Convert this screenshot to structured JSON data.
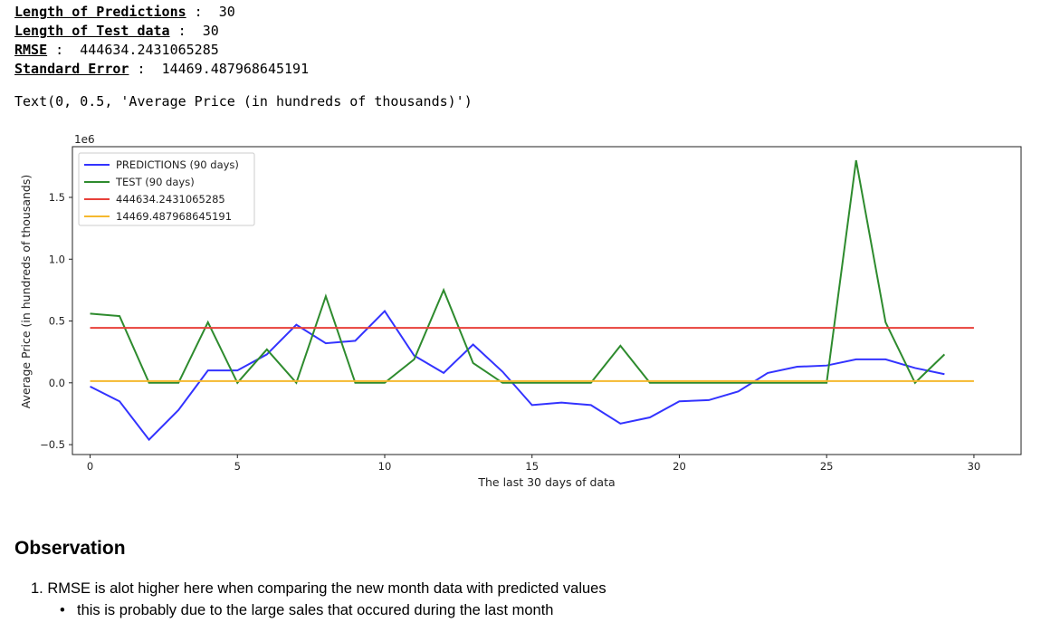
{
  "stats": {
    "pred_label": "Length of Predictions",
    "pred_value": "30",
    "test_label": "Length of Test data",
    "test_value": "30",
    "rmse_label": "RMSE",
    "rmse_value": "444634.2431065285",
    "se_label": "Standard Error",
    "se_value": "14469.487968645191",
    "separator": " : "
  },
  "text_output": "Text(0, 0.5, 'Average Price (in hundreds of thousands)')",
  "chart_data": {
    "type": "line",
    "xlabel": "The last 30 days of data",
    "ylabel": "Average Price (in hundreds of thousands)",
    "offset_text": "1e6",
    "xlim": [
      -0.6,
      31.6
    ],
    "ylim": [
      -0.58,
      1.91
    ],
    "xticks": [
      0,
      5,
      10,
      15,
      20,
      25,
      30
    ],
    "yticks": [
      -0.5,
      0.0,
      0.5,
      1.0,
      1.5
    ],
    "ytick_labels": [
      "−0.5",
      "0.0",
      "0.5",
      "1.0",
      "1.5"
    ],
    "legend_position": "upper-left",
    "series": [
      {
        "name": "PREDICTIONS (90 days)",
        "color": "#3333ff",
        "x": [
          0,
          1,
          2,
          3,
          4,
          5,
          6,
          7,
          8,
          9,
          10,
          11,
          12,
          13,
          14,
          15,
          16,
          17,
          18,
          19,
          20,
          21,
          22,
          23,
          24,
          25,
          26,
          27,
          28,
          29
        ],
        "values": [
          -0.03,
          -0.15,
          -0.46,
          -0.22,
          0.1,
          0.1,
          0.23,
          0.47,
          0.32,
          0.34,
          0.58,
          0.22,
          0.08,
          0.31,
          0.09,
          -0.18,
          -0.16,
          -0.18,
          -0.33,
          -0.28,
          -0.15,
          -0.14,
          -0.07,
          0.08,
          0.13,
          0.14,
          0.19,
          0.19,
          0.12,
          0.07
        ]
      },
      {
        "name": "TEST (90 days)",
        "color": "#2e8b2e",
        "x": [
          0,
          1,
          2,
          3,
          4,
          5,
          6,
          7,
          8,
          9,
          10,
          11,
          12,
          13,
          14,
          15,
          16,
          17,
          18,
          19,
          20,
          21,
          22,
          23,
          24,
          25,
          26,
          27,
          28,
          29
        ],
        "values": [
          0.56,
          0.54,
          0.0,
          0.0,
          0.49,
          0.0,
          0.27,
          0.0,
          0.7,
          0.0,
          0.0,
          0.19,
          0.75,
          0.16,
          0.0,
          0.0,
          0.0,
          0.0,
          0.3,
          0.0,
          0.0,
          0.0,
          0.0,
          0.0,
          0.0,
          0.0,
          1.8,
          0.49,
          0.0,
          0.23
        ]
      },
      {
        "name": "444634.2431065285",
        "color": "#e8403a",
        "x": [
          0,
          30
        ],
        "values": [
          0.444634,
          0.444634
        ]
      },
      {
        "name": "14469.487968645191",
        "color": "#f5b82e",
        "x": [
          0,
          30
        ],
        "values": [
          0.014469,
          0.014469
        ]
      }
    ]
  },
  "observation": {
    "title": "Observation",
    "item_number": "1.",
    "item_text": "RMSE is alot higher here when comparing the new month data with predicted values",
    "bullet": "•",
    "sub_text": "this is probably due to the large sales that occured during the last month"
  }
}
